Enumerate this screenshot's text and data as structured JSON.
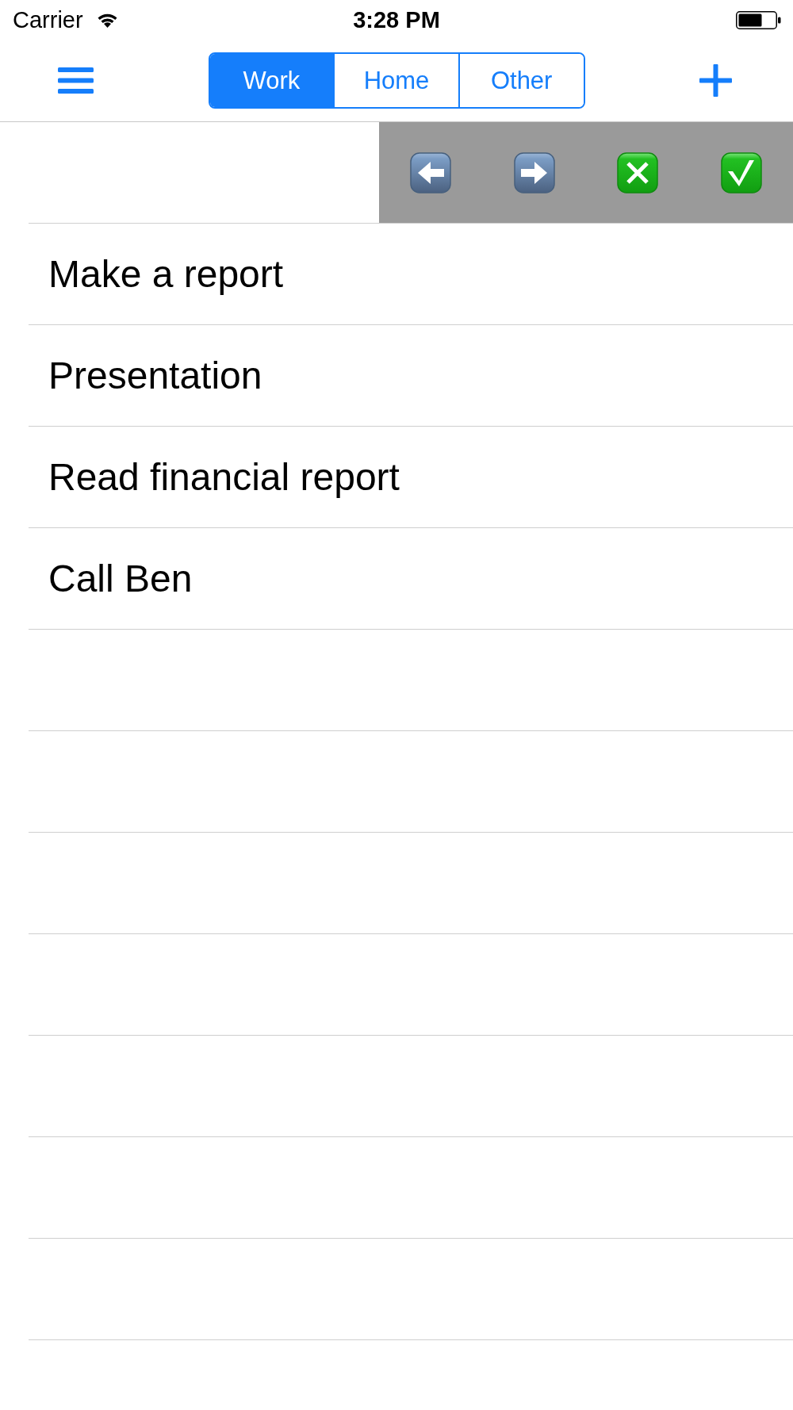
{
  "status_bar": {
    "carrier": "Carrier",
    "time": "3:28 PM"
  },
  "nav_bar": {
    "segments": [
      {
        "label": "Work",
        "selected": true
      },
      {
        "label": "Home",
        "selected": false
      },
      {
        "label": "Other",
        "selected": false
      }
    ]
  },
  "swiped_row": {
    "actions": [
      {
        "kind": "move_left"
      },
      {
        "kind": "move_right"
      },
      {
        "kind": "delete"
      },
      {
        "kind": "complete"
      }
    ]
  },
  "tasks": [
    {
      "title": "Make a report"
    },
    {
      "title": "Presentation"
    },
    {
      "title": "Read financial report"
    },
    {
      "title": "Call Ben"
    }
  ]
}
